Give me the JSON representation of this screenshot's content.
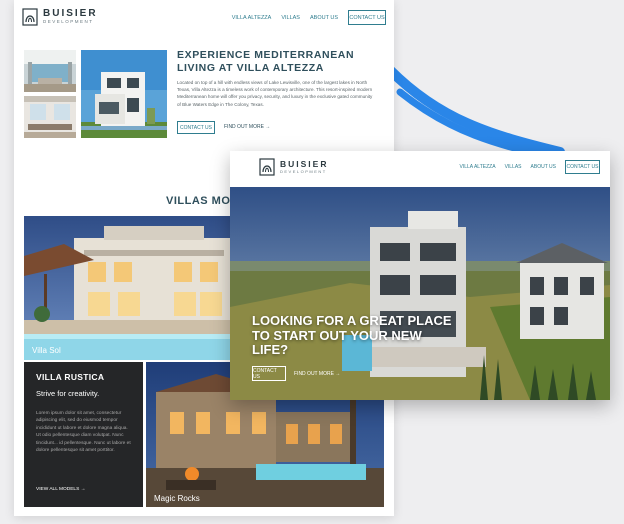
{
  "back_page": {
    "logo": {
      "name": "BUISIER",
      "sub": "DEVELOPMENT"
    },
    "nav": {
      "links": [
        "VILLA ALTEZZA",
        "VILLAS",
        "ABOUT US"
      ],
      "cta": "CONTACT US"
    },
    "feature": {
      "title": "EXPERIENCE MEDITERRANEAN LIVING AT VILLA ALTEZZA",
      "body": "Located on top of a hill with endless views of Lake Lewisville, one of the largest lakes in North Texas, Villa Altezza is a timeless work of contemporary architecture. This resort-inspired modern Mediterranean home will offer you privacy, security, and luxury in the exclusive gated community of Blue Waters Edge in The Colony, Texas.",
      "button": "CONTACT US",
      "more": "FIND OUT MORE →"
    },
    "section_title": "VILLAS MODE",
    "villa_sol": "Villa Sol",
    "villa_rustica": {
      "title": "VILLA RUSTICA",
      "tagline": "Strive for creativity.",
      "body": "Lorem ipsum dolor sit amet, consectetur adipiscing elit, sed do eiusmod tempor incididunt ut labore et dolore magna aliqua. Ut odio pellentesque diam volutpat. Nunc tincidunt... id pellentesque. Nunc ut labore et dolore pellentesque sit amet porttitor.",
      "link": "VIEW ALL MODELS →"
    },
    "magic_rocks": "Magic Rocks"
  },
  "front_page": {
    "logo": {
      "name": "BUISIER",
      "sub": "DEVELOPMENT"
    },
    "nav": {
      "links": [
        "VILLA ALTEZZA",
        "VILLAS",
        "ABOUT US"
      ],
      "cta": "CONTACT US"
    },
    "hero": {
      "title": "LOOKING FOR A GREAT PLACE TO START OUT YOUR NEW LIFE?",
      "button": "CONTACT US",
      "more": "FIND OUT MORE →"
    }
  },
  "colors": {
    "accent": "#2f7d8f",
    "heading": "#2f4f5c",
    "dark_panel": "#252628",
    "swoosh": "#2a86e8"
  }
}
